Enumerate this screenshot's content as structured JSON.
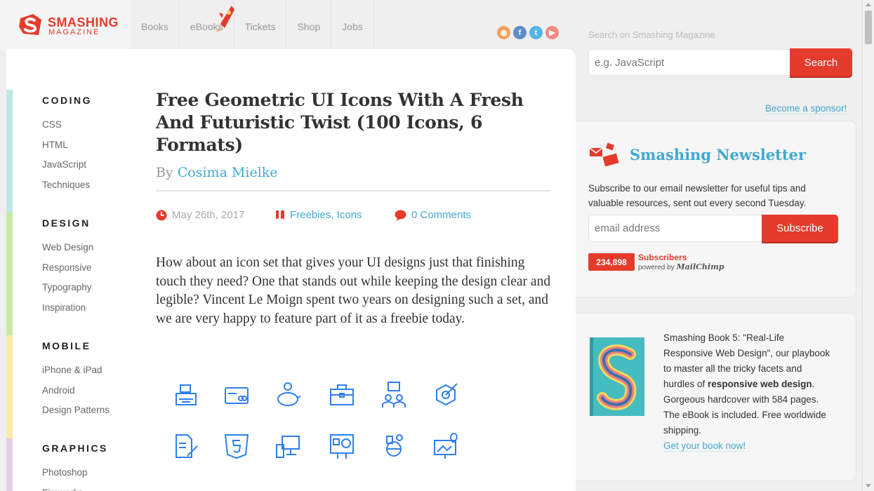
{
  "logo": {
    "title": "SMASHING",
    "subtitle": "MAGAZINE"
  },
  "nav": [
    "Books",
    "eBooks",
    "Tickets",
    "Shop",
    "Jobs"
  ],
  "social": [
    {
      "icon": "rss-icon",
      "glyph": "◉",
      "color": "#f0a35c"
    },
    {
      "icon": "facebook-icon",
      "glyph": "f",
      "color": "#5f8dc7"
    },
    {
      "icon": "twitter-icon",
      "glyph": "t",
      "color": "#55b5e6"
    },
    {
      "icon": "youtube-icon",
      "glyph": "▶",
      "color": "#f18a80"
    }
  ],
  "search": {
    "label": "Search on Smashing Magazine",
    "placeholder": "e.g. JavaScript",
    "button": "Search"
  },
  "categories": [
    {
      "title": "CODING",
      "color": "#bfe7e6",
      "links": [
        "CSS",
        "HTML",
        "JavaScript",
        "Techniques"
      ]
    },
    {
      "title": "DESIGN",
      "color": "#c6ea9f",
      "links": [
        "Web Design",
        "Responsive",
        "Typography",
        "Inspiration"
      ]
    },
    {
      "title": "MOBILE",
      "color": "#fbe9a6",
      "links": [
        "iPhone & iPad",
        "Android",
        "Design Patterns"
      ]
    },
    {
      "title": "GRAPHICS",
      "color": "#e5cde5",
      "links": [
        "Photoshop",
        "Fireworks"
      ]
    }
  ],
  "article": {
    "title": "Free Geometric UI Icons With A Fresh And Futuristic Twist (100 Icons, 6 Formats)",
    "by": "By",
    "author": "Cosima Mielke",
    "date": "May 26th, 2017",
    "tags": "Freebies, Icons",
    "comments": "0 Comments",
    "lead": "How about an icon set that gives your UI designs just that finishing touch they need? One that stands out while keeping the design clear and legible? Vincent Le Moign spent two years on designing such a set, and we are very happy to feature part of it as a freebie today."
  },
  "icon_grid": [
    "cash-register-icon",
    "credit-card-icon",
    "piggy-bank-icon",
    "briefcase-icon",
    "team-money-icon",
    "target-icon",
    "document-edit-icon",
    "html5-shield-icon",
    "devices-icon",
    "film-slide-icon",
    "bug-robot-icon",
    "location-monitor-icon"
  ],
  "sidebar": {
    "sponsor": "Become a sponsor!",
    "newsletter": {
      "title": "Smashing Newsletter",
      "desc": "Subscribe to our email newsletter for useful tips and valuable resources, sent out every second Tuesday.",
      "placeholder": "email address",
      "button": "Subscribe",
      "count": "234,898",
      "subs_label": "Subscribers",
      "powered": "powered by",
      "brand": "MailChimp"
    },
    "book": {
      "text1": "Smashing Book 5: \"Real-Life Responsive Web Design\", our playbook to master all the tricky facets and hurdles of ",
      "bold": "responsive web design",
      "text2": ". Gorgeous hardcover with 584 pages. The eBook is included. Free worldwide shipping.",
      "link": "Get your book now!"
    }
  },
  "colors": {
    "accent": "#e53b2c",
    "link": "#41a8d0"
  }
}
